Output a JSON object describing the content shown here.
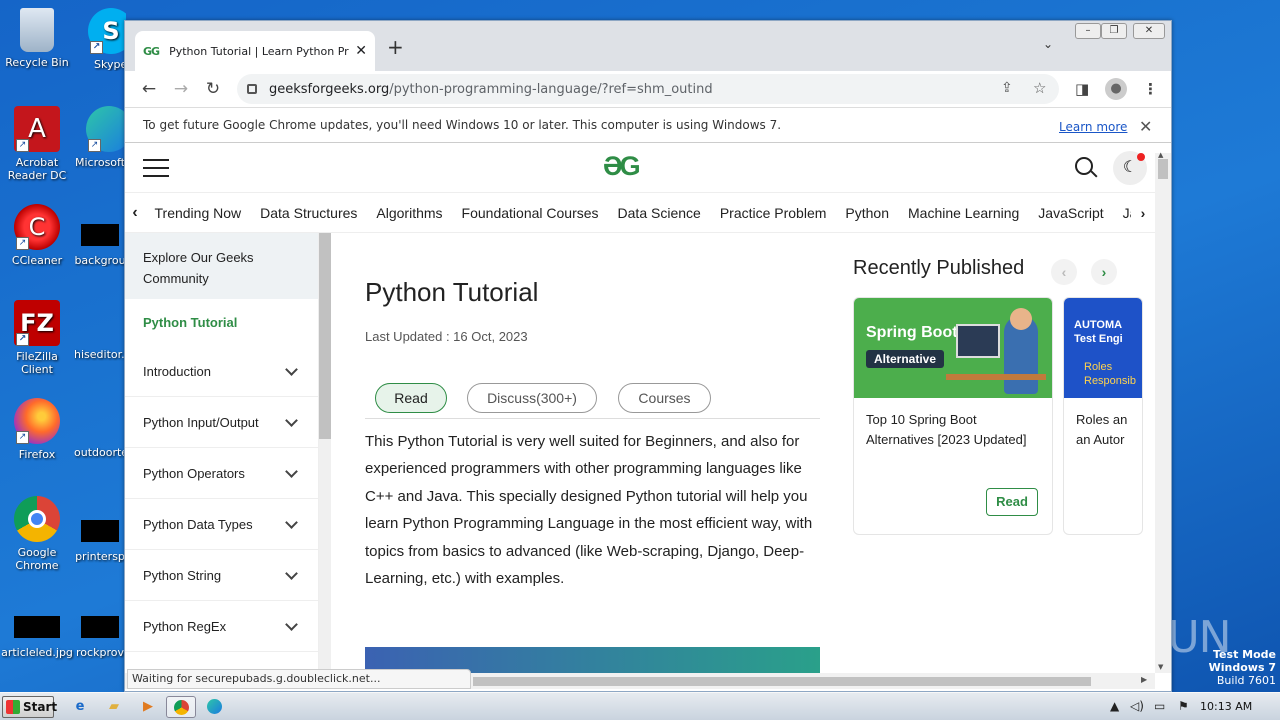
{
  "desktop": {
    "icons_col1": [
      {
        "label": "Recycle Bin",
        "icon": "recycle-bin-icon"
      },
      {
        "label": "Acrobat Reader DC",
        "icon": "acrobat-icon"
      },
      {
        "label": "CCleaner",
        "icon": "ccleaner-icon"
      },
      {
        "label": "FileZilla Client",
        "icon": "filezilla-icon"
      },
      {
        "label": "Firefox",
        "icon": "firefox-icon"
      },
      {
        "label": "Google Chrome",
        "icon": "chrome-icon"
      },
      {
        "label": "articleled.jpg",
        "icon": "image-file-icon"
      }
    ],
    "icons_col2": [
      {
        "label": "Skype",
        "icon": "skype-icon"
      },
      {
        "label": "Microsoft",
        "icon": "edge-icon"
      },
      {
        "label": "backgrou",
        "icon": "file-icon"
      },
      {
        "label": "hiseditor...",
        "icon": "file-icon"
      },
      {
        "label": "outdoorte",
        "icon": "file-icon"
      },
      {
        "label": "printersp",
        "icon": "file-icon"
      },
      {
        "label": "rockprov",
        "icon": "file-icon"
      }
    ],
    "watermark": "ANY RUN",
    "test_mode": {
      "line1": "Test Mode",
      "line2": "Windows 7",
      "line3": "Build 7601"
    }
  },
  "browser": {
    "tab_title": "Python Tutorial | Learn Python Progr",
    "tab_favicon": "GG",
    "new_tab": "+",
    "url_host": "geeksforgeeks.org",
    "url_path": "/python-programming-language/?ref=shm_outind",
    "infobar_text": "To get future Google Chrome updates, you'll need Windows 10 or later. This computer is using Windows 7.",
    "infobar_link": "Learn more",
    "status_text": "Waiting for securepubads.g.doubleclick.net..."
  },
  "page": {
    "logo": "ƏG",
    "categories": [
      "Trending Now",
      "Data Structures",
      "Algorithms",
      "Foundational Courses",
      "Data Science",
      "Practice Problem",
      "Python",
      "Machine Learning",
      "JavaScript",
      "Ja"
    ],
    "sidebar": {
      "community": "Explore Our Geeks Community",
      "active": "Python Tutorial",
      "items": [
        "Introduction",
        "Python Input/Output",
        "Python Operators",
        "Python Data Types",
        "Python String",
        "Python RegEx"
      ]
    },
    "article": {
      "title": "Python Tutorial",
      "updated": "Last Updated : 16 Oct, 2023",
      "pills": [
        "Read",
        "Discuss(300+)",
        "Courses"
      ],
      "body": "This Python Tutorial is very well suited for Beginners, and also for experienced programmers with other programming languages like C++ and Java. This specially designed Python tutorial will help you learn Python Programming Language in the most efficient way, with topics from basics to advanced (like Web-scraping, Django, Deep-Learning, etc.) with examples."
    },
    "recent": {
      "title": "Recently Published",
      "card1": {
        "img_line1": "Spring Boot",
        "img_line2": "Alternative",
        "text": "Top 10 Spring Boot Alternatives [2023 Updated]",
        "button": "Read"
      },
      "card2": {
        "img_line1": "AUTOMA",
        "img_line2": "Test Engi",
        "img_line3": "Roles",
        "img_line4": "Responsib",
        "text_line1": "Roles an",
        "text_line2": "an Autor"
      }
    }
  },
  "taskbar": {
    "start": "Start",
    "clock": "10:13 AM"
  }
}
